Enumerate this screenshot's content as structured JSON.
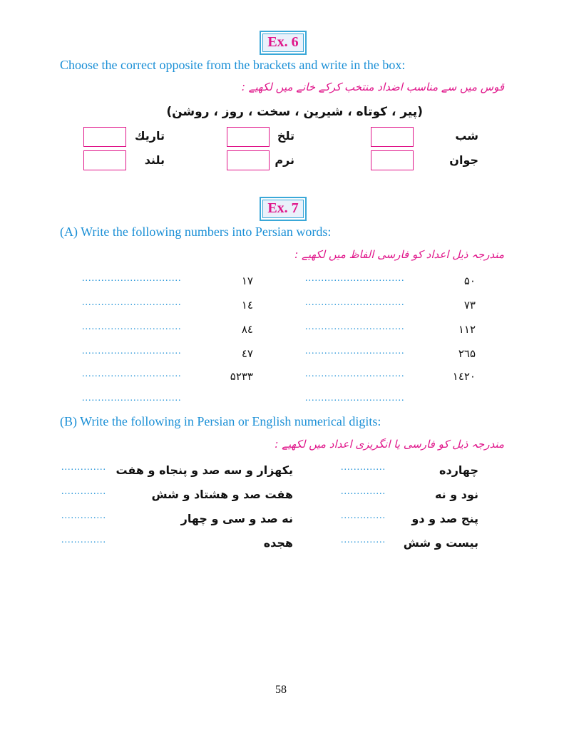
{
  "ex6": {
    "label": "Ex. 6",
    "instruction_en": "Choose the correct opposite from the brackets and write in the box:",
    "instruction_ur": "قوس میں سے مناسب اضداد منتخب کرکے خانے میں لکھیے :",
    "options": "(پیر ، کوتاه ، شیرین ، سخت ، روز ، روشن)",
    "words": [
      "شب",
      "تلخ",
      "تاريك",
      "جوان",
      "نرم",
      "بلند"
    ]
  },
  "ex7": {
    "label": "Ex. 7",
    "partA": {
      "instruction_en": "(A)   Write the following numbers into Persian words:",
      "instruction_ur": "مندرجہ ذیل اعداد کو فارسی الفاظ میں لکھیے :",
      "dots": "...............................",
      "numbers": [
        "۵۰",
        "۱۷",
        "۷۳",
        "۱٤",
        "۱۱۲",
        "۸٤",
        "۲٦۵",
        "٤۷",
        "۱٤۲۰",
        "۵۲۳۳"
      ]
    },
    "partB": {
      "instruction_en": "(B)   Write the following in Persian or English numerical digits:",
      "instruction_ur": "مندرجہ ذیل کو فارسی یا انگریزی اعداد میں لکھیے :",
      "dots": "..............",
      "items": [
        "چهارده",
        "يكهزار و سه صد و پنجاه و هفت",
        "نود و نه",
        "هفت صد و هشتاد و شش",
        "پنج صد و دو",
        "نه صد و سی و چهار",
        "بیست و شش",
        "هجده"
      ]
    }
  },
  "page_number": "58"
}
